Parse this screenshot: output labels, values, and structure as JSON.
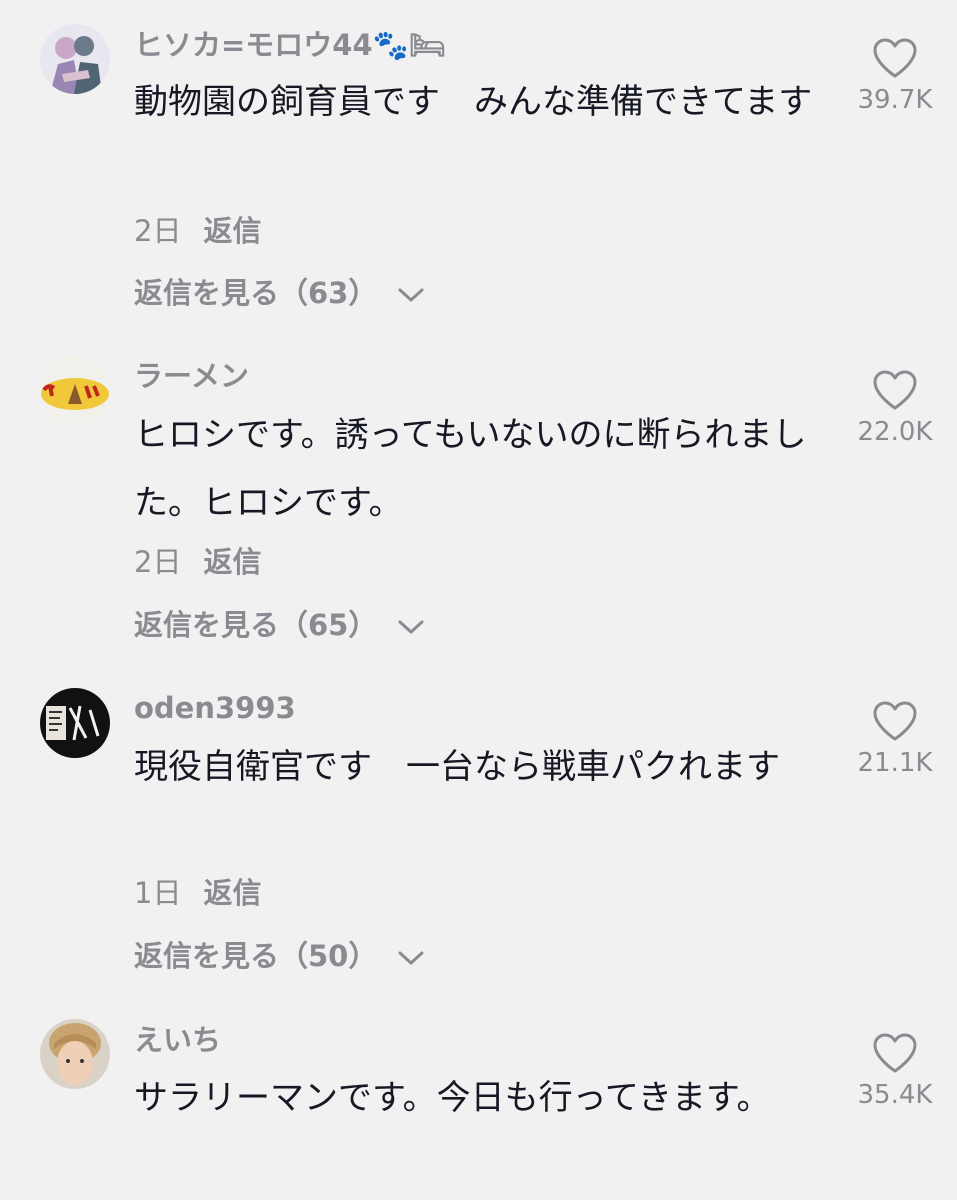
{
  "comments": [
    {
      "username": "ヒソカ=モロウ44🐾🛏",
      "text": "動物園の飼育員です　みんな準備できてます",
      "date": "2日",
      "reply_label": "返信",
      "view_replies": "返信を見る（63）",
      "likes": "39.7K"
    },
    {
      "username": "ラーメン",
      "text": "ヒロシです。誘ってもいないのに断られました。ヒロシです。",
      "date": "2日",
      "reply_label": "返信",
      "view_replies": "返信を見る（65）",
      "likes": "22.0K"
    },
    {
      "username": "oden3993",
      "text": "現役自衛官です　一台なら戦車パクれます",
      "date": "1日",
      "reply_label": "返信",
      "view_replies": "返信を見る（50）",
      "likes": "21.1K"
    },
    {
      "username": "えいち",
      "text": "サラリーマンです。今日も行ってきます。",
      "likes": "35.4K"
    }
  ],
  "icons": {
    "like": "heart-outline-icon",
    "expand": "chevron-down-icon"
  },
  "colors": {
    "background": "#f1f1f2",
    "primary_text": "#161823",
    "secondary_text": "#8a8b91"
  }
}
